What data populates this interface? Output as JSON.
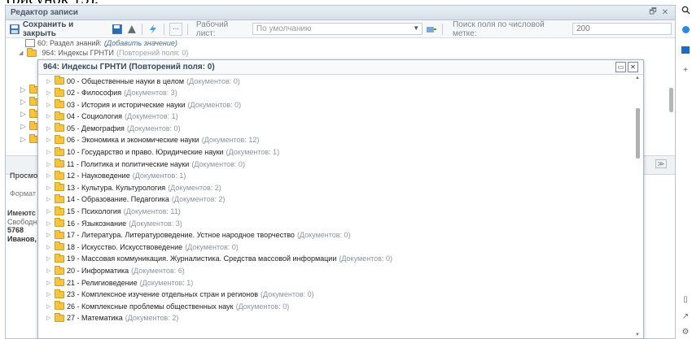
{
  "window": {
    "title": "Редактор записи"
  },
  "toolbar": {
    "save_label": "Сохранить и закрыть",
    "sheet_label": "Рабочий лист:",
    "sheet_value": "По умолчанию",
    "search_label": "Поиск поля по числовой метке:",
    "search_placeholder": "200"
  },
  "record": {
    "field60": "60: Раздел знаний:",
    "field60_add": "(Добавить значение)",
    "field964": "964: Индексы ГРНТИ",
    "field964_count": "(Повторений поля: 0)"
  },
  "lower": {
    "prosmo": "Просмо",
    "format": "Формат",
    "imeyuts": "Имеютс",
    "svobodn": "Свободн",
    "num": "5768",
    "ivanov": "Иванов,"
  },
  "popup": {
    "title": "964: Индексы ГРНТИ (Повторений поля: 0)",
    "items": [
      {
        "label": "00 - Общественные науки в целом",
        "count": "(Документов: 0)"
      },
      {
        "label": "02 - Философия",
        "count": "(Документов: 3)"
      },
      {
        "label": "03 - История и исторические науки",
        "count": "(Документов: 0)"
      },
      {
        "label": "04 - Социология",
        "count": "(Документов: 1)"
      },
      {
        "label": "05 - Демография",
        "count": "(Документов: 0)"
      },
      {
        "label": "06 - Экономика и экономические науки",
        "count": "(Документов: 12)"
      },
      {
        "label": "10 - Государство и право. Юридические науки",
        "count": "(Документов: 1)"
      },
      {
        "label": "11 - Политика и политические науки",
        "count": "(Документов: 0)"
      },
      {
        "label": "12 - Науковедение",
        "count": "(Документов: 1)"
      },
      {
        "label": "13 - Культура. Культурология",
        "count": "(Документов: 2)"
      },
      {
        "label": "14 - Образование. Педагогика",
        "count": "(Документов: 2)"
      },
      {
        "label": "15 - Психология",
        "count": "(Документов: 11)"
      },
      {
        "label": "16 - Языкознание",
        "count": "(Документов: 3)"
      },
      {
        "label": "17 - Литература. Литературоведение. Устное народное творчество",
        "count": "(Документов: 0)"
      },
      {
        "label": "18 - Искусство. Искусствоведение",
        "count": "(Документов: 0)"
      },
      {
        "label": "19 - Массовая коммуникация. Журналистика. Средства массовой информации",
        "count": "(Документов: 0)"
      },
      {
        "label": "20 - Информатика",
        "count": "(Документов: 6)"
      },
      {
        "label": "21 - Религиоведение",
        "count": "(Документов: 1)"
      },
      {
        "label": "23 - Комплексное изучение отдельных стран и регионов",
        "count": "(Документов: 0)"
      },
      {
        "label": "26 - Комплексные проблемы общественных наук",
        "count": "(Документов: 0)"
      },
      {
        "label": "27 - Математика",
        "count": "(Документов: 2)"
      }
    ]
  },
  "colors": {
    "folder": "#f5c542",
    "accent": "#3b6ea5",
    "muted": "#8a95a1"
  },
  "icons": [
    "save-icon",
    "sheet-icon",
    "lightning-icon",
    "ellipsis-icon",
    "dropdown-icon",
    "folder-icon",
    "search-icon",
    "settings-icon",
    "add-icon"
  ]
}
